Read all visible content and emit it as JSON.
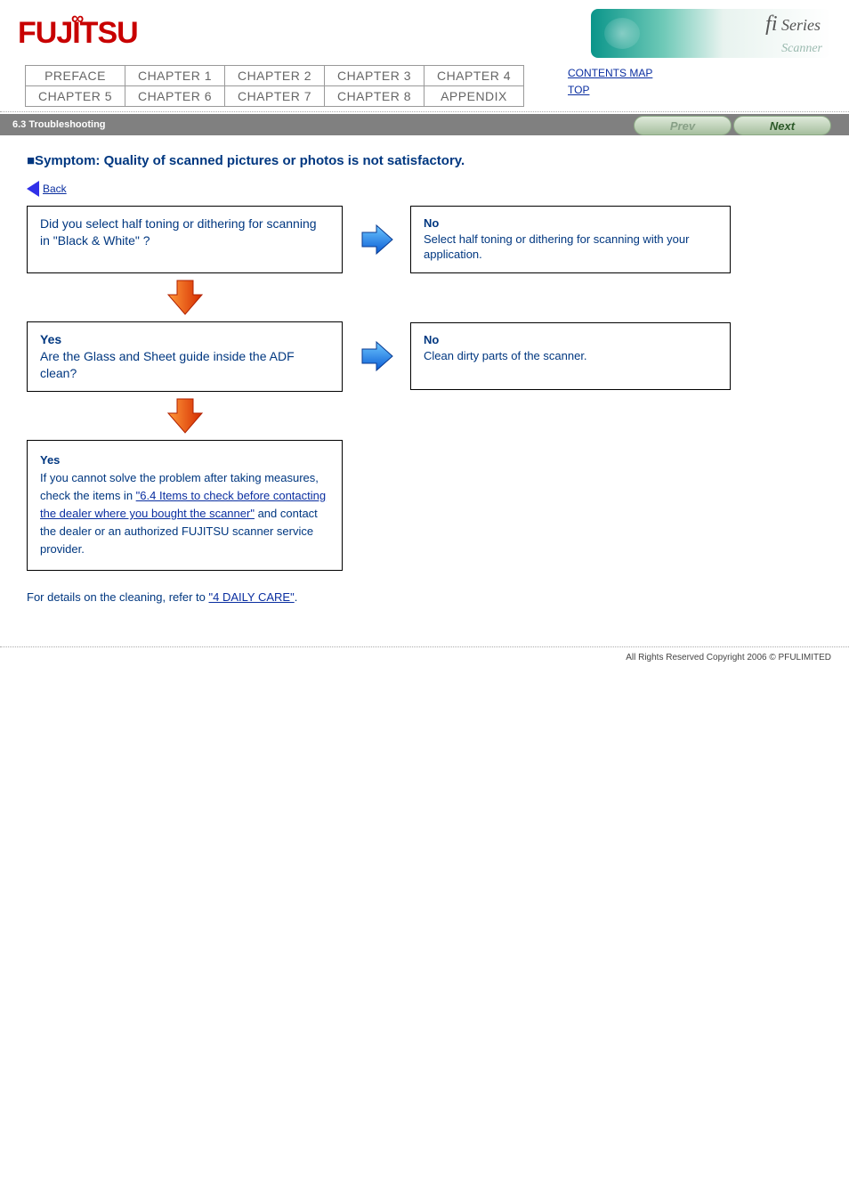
{
  "brand": "FUJITSU",
  "banner": {
    "series": "fi Series",
    "sub": "Scanner"
  },
  "nav": {
    "tabs": [
      "PREFACE",
      "CHAPTER 1",
      "CHAPTER 2",
      "CHAPTER 3",
      "CHAPTER 4",
      "CHAPTER 5",
      "CHAPTER 6",
      "CHAPTER 7",
      "CHAPTER 8",
      "APPENDIX"
    ],
    "contents": "CONTENTS MAP",
    "top": "TOP"
  },
  "bar_title": "6.3 Troubleshooting",
  "prev": "Prev",
  "next": "Next",
  "heading": "■Symptom: Quality of scanned pictures or photos is not satisfactory.",
  "back_link": "Back",
  "flow": {
    "q1": "Did you select half toning or dithering for scanning in \"Black & White\" ?",
    "a1_label": "No",
    "a1_text": "Select half toning or dithering for scanning with your application.",
    "q2": "Are the Glass and Sheet guide inside the ADF clean?",
    "a2_label": "No",
    "a2_text": "Clean dirty parts of the scanner.",
    "final_prefix": "If you cannot solve the problem after taking measures, check the items in ",
    "final_link1": "\"6.4 Items to check before contacting the dealer where you bought the scanner\"",
    "final_mid": " and contact the dealer or an authorized FUJITSU scanner service provider."
  },
  "closing_prefix": "For details on the cleaning, refer to ",
  "closing_link": "\"4 DAILY CARE\"",
  "closing_suffix": ".",
  "copyright": "All Rights Reserved Copyright 2006 © PFULIMITED"
}
